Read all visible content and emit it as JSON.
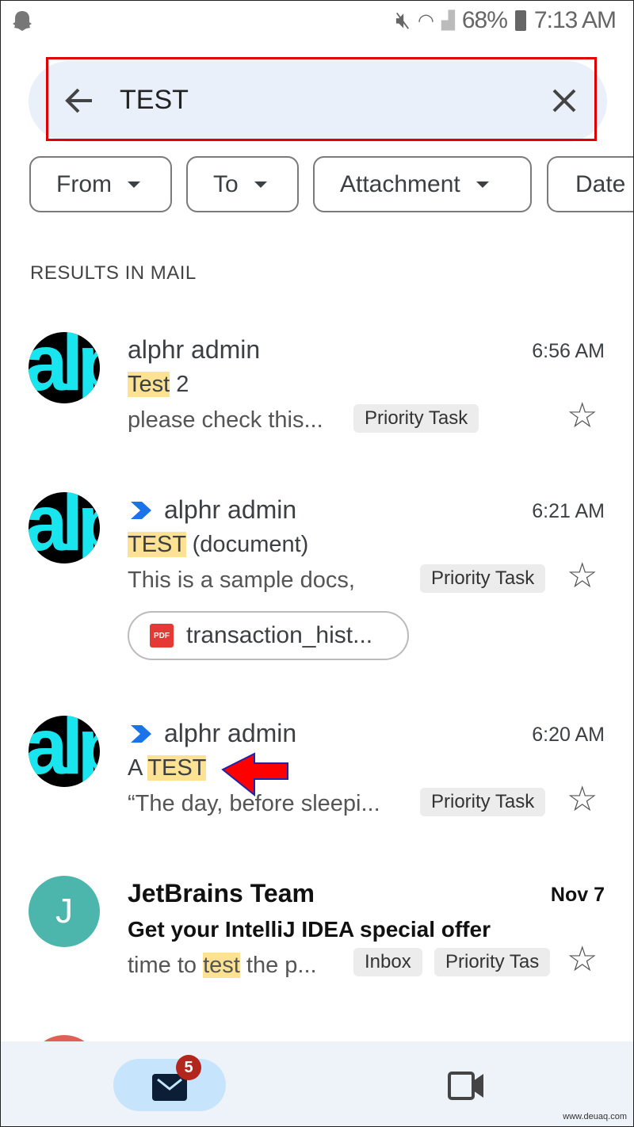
{
  "status_bar": {
    "battery": "68%",
    "time": "7:13 AM"
  },
  "search": {
    "query": "TEST"
  },
  "filters": [
    "From",
    "To",
    "Attachment",
    "Date"
  ],
  "section_title": "RESULTS IN MAIL",
  "emails": [
    {
      "avatar_text": "alp",
      "sender": "alphr admin",
      "time": "6:56 AM",
      "subject_highlight": "Test",
      "subject_rest": " 2",
      "snippet": "please check this...",
      "label": "Priority Task",
      "important": false
    },
    {
      "avatar_text": "alp",
      "sender": "alphr admin",
      "time": "6:21 AM",
      "subject_highlight": "TEST",
      "subject_rest": " (document)",
      "snippet": "This is a sample docs,",
      "label": "Priority Task",
      "important": true,
      "attachment": "transaction_hist...",
      "attachment_type": "PDF"
    },
    {
      "avatar_text": "alp",
      "sender": "alphr admin",
      "time": "6:20 AM",
      "subject_pre": "A ",
      "subject_highlight": "TEST",
      "snippet": "“The day, before sleepi...",
      "label": "Priority Task",
      "important": true
    },
    {
      "avatar_text": "J",
      "avatar_color": "#4db6ac",
      "sender": "JetBrains Team",
      "time": "Nov 7",
      "subject": "Get your IntelliJ IDEA special offer",
      "snippet_pre": "time to ",
      "snippet_highlight": "test",
      "snippet_post": " the p...",
      "labels": [
        "Inbox",
        "Priority Tas"
      ]
    }
  ],
  "bottom_nav": {
    "mail_badge": "5"
  },
  "watermark": "www.deuaq.com",
  "colors": {
    "highlight": "#fde293",
    "annotation_box": "#e00000",
    "annotation_arrow": "#ff0000",
    "important_marker": "#1a73e8"
  }
}
